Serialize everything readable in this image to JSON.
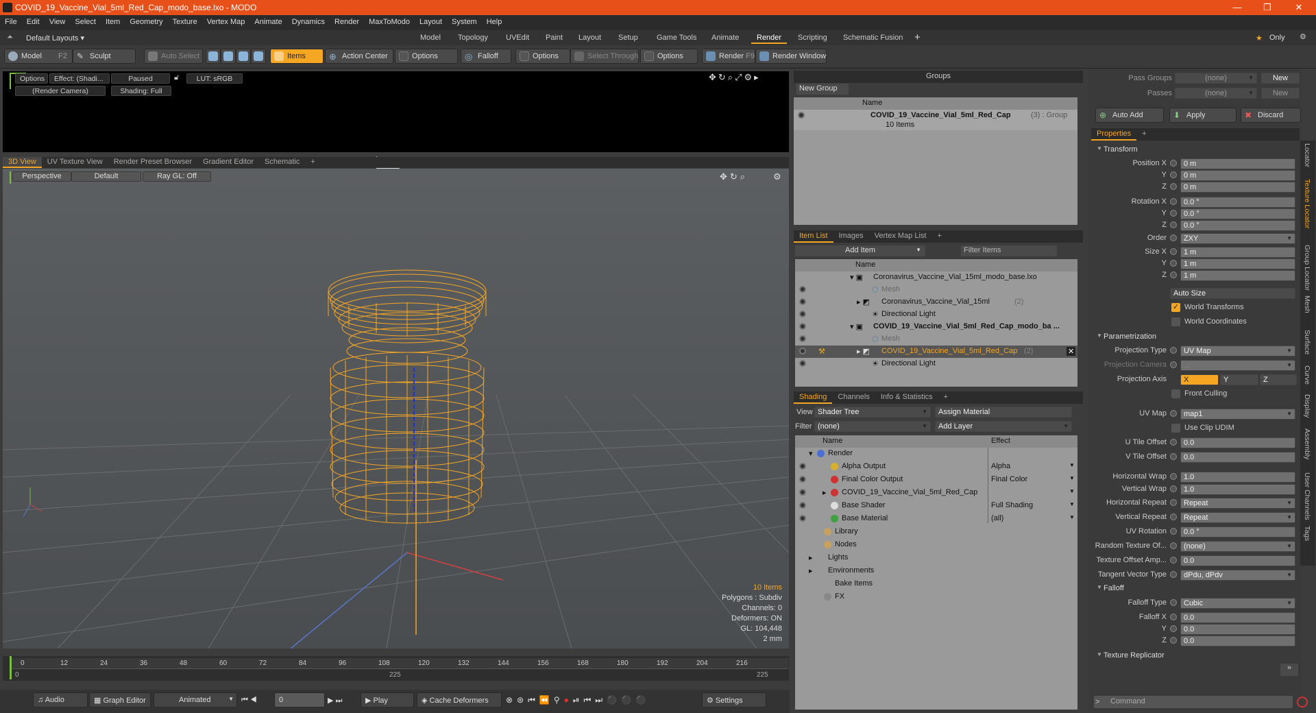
{
  "window": {
    "title": "COVID_19_Vaccine_Vial_5ml_Red_Cap_modo_base.lxo - MODO"
  },
  "menu": [
    "File",
    "Edit",
    "View",
    "Select",
    "Item",
    "Geometry",
    "Texture",
    "Vertex Map",
    "Animate",
    "Dynamics",
    "Render",
    "MaxToModo",
    "Layout",
    "System",
    "Help"
  ],
  "layoutbar": {
    "default_layouts": "Default Layouts",
    "tabs": [
      "Model",
      "Topology",
      "UVEdit",
      "Paint",
      "Layout",
      "Setup",
      "Game Tools",
      "Animate",
      "Render",
      "Scripting",
      "Schematic Fusion"
    ],
    "active_tab": "Render",
    "only": "Only"
  },
  "toolbar": {
    "model": "Model",
    "model_key": "F2",
    "sculpt": "Sculpt",
    "auto_select": "Auto Select",
    "items": "Items",
    "action_center": "Action Center",
    "options1": "Options",
    "falloff": "Falloff",
    "options2": "Options",
    "select_through": "Select Through",
    "options3": "Options",
    "render": "Render",
    "render_key": "F9",
    "render_window": "Render Window"
  },
  "render_view": {
    "options": "Options",
    "effect": "Effect: (Shadi...",
    "paused": "Paused",
    "lut": "LUT: sRGB",
    "camera": "(Render Camera)",
    "shading": "Shading: Full"
  },
  "viewport_tabs": [
    "3D View",
    "UV Texture View",
    "Render Preset Browser",
    "Gradient Editor",
    "Schematic"
  ],
  "viewport": {
    "perspective": "Perspective",
    "default": "Default",
    "raygl": "Ray GL: Off",
    "info": {
      "items": "10 Items",
      "polygons": "Polygons : Subdiv",
      "channels": "Channels: 0",
      "deformers": "Deformers: ON",
      "gl": "GL: 104,448",
      "scale": "2 mm"
    }
  },
  "timeline": {
    "ticks": [
      "0",
      "12",
      "24",
      "36",
      "48",
      "60",
      "72",
      "84",
      "96",
      "108",
      "120",
      "132",
      "144",
      "156",
      "168",
      "180",
      "192",
      "204",
      "216"
    ],
    "sub_left": "0",
    "sub_mid": "225",
    "sub_right": "225"
  },
  "bottombar": {
    "audio": "Audio",
    "graph_editor": "Graph Editor",
    "animated": "Animated",
    "frame": "0",
    "play": "Play",
    "cache_deformers": "Cache Deformers",
    "settings": "Settings"
  },
  "groups": {
    "title": "Groups",
    "new_group": "New Group",
    "col_name": "Name",
    "item_name": "COVID_19_Vaccine_Vial_5ml_Red_Cap",
    "item_suffix": "(3) : Group",
    "item_count": "10 Items"
  },
  "item_list": {
    "tabs": [
      "Item List",
      "Images",
      "Vertex Map List"
    ],
    "add_item": "Add Item",
    "filter_items": "Filter Items",
    "col_name": "Name",
    "rows": [
      {
        "label": "Coronavirus_Vaccine_Vial_15ml_modo_base.lxo",
        "suffix": ""
      },
      {
        "label": "Mesh",
        "suffix": ""
      },
      {
        "label": "Coronavirus_Vaccine_Vial_15ml",
        "suffix": "(2)"
      },
      {
        "label": "Directional Light",
        "suffix": ""
      },
      {
        "label": "COVID_19_Vaccine_Vial_5ml_Red_Cap_modo_ba ...",
        "suffix": ""
      },
      {
        "label": "Mesh",
        "suffix": ""
      },
      {
        "label": "COVID_19_Vaccine_Vial_5ml_Red_Cap",
        "suffix": "(2)"
      },
      {
        "label": "Directional Light",
        "suffix": ""
      }
    ]
  },
  "shading": {
    "tabs": [
      "Shading",
      "Channels",
      "Info & Statistics"
    ],
    "view_label": "View",
    "view_value": "Shader Tree",
    "assign_material": "Assign Material",
    "filter_label": "Filter",
    "filter_value": "(none)",
    "add_layer": "Add Layer",
    "col_name": "Name",
    "col_effect": "Effect",
    "rows": [
      {
        "name": "Render",
        "effect": ""
      },
      {
        "name": "Alpha Output",
        "effect": "Alpha"
      },
      {
        "name": "Final Color Output",
        "effect": "Final Color"
      },
      {
        "name": "COVID_19_Vaccine_Vial_5ml_Red_Cap",
        "effect": ""
      },
      {
        "name": "Base Shader",
        "effect": "Full Shading"
      },
      {
        "name": "Base Material",
        "effect": "(all)"
      },
      {
        "name": "Library",
        "effect": ""
      },
      {
        "name": "Nodes",
        "effect": ""
      },
      {
        "name": "Lights",
        "effect": ""
      },
      {
        "name": "Environments",
        "effect": ""
      },
      {
        "name": "Bake Items",
        "effect": ""
      },
      {
        "name": "FX",
        "effect": ""
      }
    ]
  },
  "passes": {
    "pass_groups_label": "Pass Groups",
    "pass_groups_value": "(none)",
    "new1": "New",
    "passes_label": "Passes",
    "passes_value": "(none)",
    "new2": "New",
    "auto_add": "Auto Add",
    "apply": "Apply",
    "discard": "Discard"
  },
  "properties": {
    "tab": "Properties",
    "transform": "Transform",
    "position_label": "Position X",
    "pos_x": "0 m",
    "pos_y": "0 m",
    "pos_z": "0 m",
    "rotation_label": "Rotation X",
    "rot_x": "0.0 °",
    "rot_y": "0.0 °",
    "rot_z": "0.0 °",
    "order_label": "Order",
    "order": "ZXY",
    "size_label": "Size X",
    "size_x": "1 m",
    "size_y": "1 m",
    "size_z": "1 m",
    "y": "Y",
    "z": "Z",
    "auto_size": "Auto Size",
    "world_transforms": "World Transforms",
    "world_coordinates": "World Coordinates",
    "parametrization": "Parametrization",
    "projection_type_label": "Projection Type",
    "projection_type": "UV Map",
    "projection_camera_label": "Projection Camera",
    "projection_camera": "...",
    "projection_axis_label": "Projection Axis",
    "axis_x": "X",
    "axis_y": "Y",
    "axis_z": "Z",
    "front_culling": "Front Culling",
    "uv_map_label": "UV Map",
    "uv_map": "map1",
    "use_clip_udim": "Use Clip UDIM",
    "u_offset_label": "U Tile Offset",
    "u_offset": "0.0",
    "v_offset_label": "V Tile Offset",
    "v_offset": "0.0",
    "h_wrap_label": "Horizontal Wrap",
    "h_wrap": "1.0",
    "v_wrap_label": "Vertical Wrap",
    "v_wrap": "1.0",
    "h_repeat_label": "Horizontal Repeat",
    "h_repeat": "Repeat",
    "v_repeat_label": "Vertical Repeat",
    "v_repeat": "Repeat",
    "uv_rotation_label": "UV Rotation",
    "uv_rotation": "0.0 °",
    "random_tex_label": "Random Texture Of...",
    "random_tex": "(none)",
    "tex_offset_amp_label": "Texture Offset Amp...",
    "tex_offset_amp": "0.0",
    "tangent_label": "Tangent Vector Type",
    "tangent": "dPdu, dPdv",
    "falloff": "Falloff",
    "falloff_type_label": "Falloff Type",
    "falloff_type": "Cubic",
    "falloff_x_label": "Falloff X",
    "falloff_x": "0.0",
    "falloff_y": "0.0",
    "falloff_z": "0.0",
    "texture_replicator": "Texture Replicator",
    "command_placeholder": "Command"
  },
  "side_tabs": [
    "Locator",
    "Texture Locator",
    "Group Locator",
    "Mesh",
    "Surface",
    "Curve",
    "Display",
    "Assembly",
    "User Channels",
    "Tags"
  ],
  "colors": {
    "accent": "#f5a623",
    "titlebar": "#e8501a",
    "wire": "#f5a623"
  }
}
